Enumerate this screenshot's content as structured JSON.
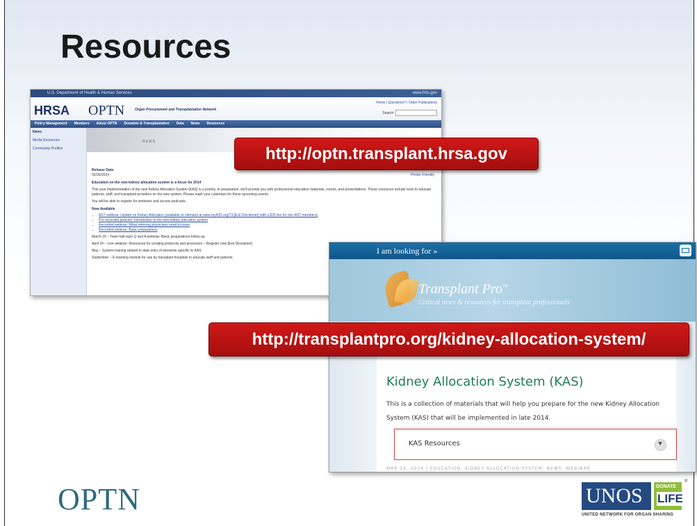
{
  "slide": {
    "title": "Resources"
  },
  "optn_site": {
    "gov_bar": "U.S. Department of Health & Human Services",
    "gov_right": "www.hhs.gov",
    "hrsa": "HRSA",
    "optn": "OPTN",
    "optn_sub": "Organ Procurement and Transplantation Network",
    "toplinks": "Home | Questions? | Order Publications",
    "search_label": "Search:",
    "nav": [
      "Policy Management",
      "Members",
      "About OPTN",
      "Donation & Transplantation",
      "Data",
      "News",
      "Resources"
    ],
    "sidebar": [
      "News",
      "Media Resources",
      "Community Profiles"
    ],
    "banner": "NEWS",
    "print_link": "Printer Friendly",
    "release_label": "Release Date:",
    "release_date": "02/26/2014",
    "headline": "Education on the new kidney allocation system is a focus for 2014",
    "para1": "This year implementation of the new Kidney Allocation System (KAS) is a priority. In preparation, we'll provide you with professional education materials, events, and presentations. These resources include tools to educate patients, staff, and transplant providers on the new system. Please mark your calendars for these upcoming events.",
    "para2": "You will be able to register for webinars and access podcasts.",
    "now_available": "Now Available",
    "bullets": [
      "AST webinar: Update on Kidney Allocation (available on demand at www.myAST.org/73 [Exit Disclaimer] with a $25 fee for non-AST members)",
      "Pre-recorded podcast: Introduction to the new kidney allocation system",
      "Recorded webinar: What referring physicians need to know",
      "Recorded webinar: Basic preparations"
    ],
    "march": "March 20 – Town hall-style Q and A webinar: Basic preparations follow-up",
    "april": "April 24 – Live webinar: Resources for creating protocols and processes – Register now [Exit Disclaimer]",
    "may": "May – System training related to data entry of elements specific to KAS",
    "september": "September – E-learning module for use by transplant hospitals to educate staff and patients"
  },
  "url1": "http://optn.transplant.hrsa.gov",
  "url2": "http://transplantpro.org/kidney-allocation-system/",
  "transplant_pro": {
    "looking_for": "I am looking for »",
    "brand": "Transplant Pro",
    "brand_mark": "™",
    "tagline": "Critical news & resources for transplant professionals",
    "heading": "Kidney Allocation System (KAS)",
    "description": "This is a collection of materials that will help you prepare for the new Kidney Allocation System (KAS) that will be implemented in late 2014.",
    "resources_label": "KAS Resources",
    "meta": "MAR 24, 2014 | EDUCATION, KIDNEY ALLOCATION SYSTEM, NEWS, WEBINAR"
  },
  "footer": {
    "optn_logo": "OPTN",
    "unos_word": "UNOS",
    "donate": "DONATE",
    "life": "LIFE",
    "reg": "®",
    "unos_tagline": "UNITED NETWORK FOR ORGAN SHARING"
  }
}
